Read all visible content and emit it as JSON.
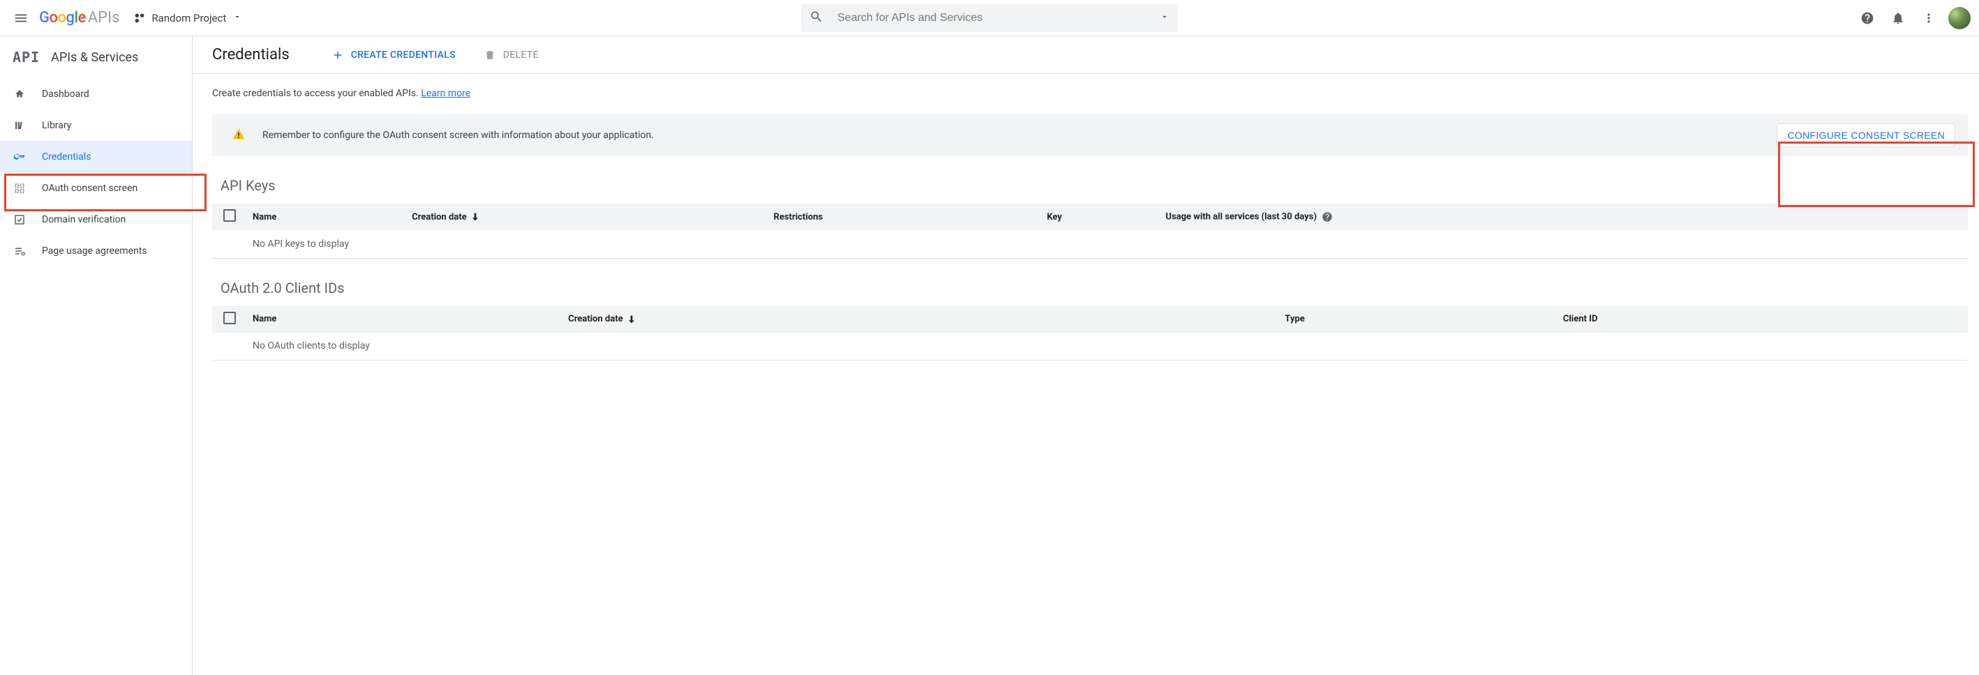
{
  "header": {
    "logo_apis": "APIs",
    "project_name": "Random Project",
    "search_placeholder": "Search for APIs and Services"
  },
  "sidebar": {
    "section_title": "APIs & Services",
    "api_mark": "API",
    "items": [
      {
        "label": "Dashboard"
      },
      {
        "label": "Library"
      },
      {
        "label": "Credentials"
      },
      {
        "label": "OAuth consent screen"
      },
      {
        "label": "Domain verification"
      },
      {
        "label": "Page usage agreements"
      }
    ]
  },
  "page": {
    "title": "Credentials",
    "create_label": "Create Credentials",
    "delete_label": "Delete",
    "intro_text": "Create credentials to access your enabled APIs. ",
    "learn_more": "Learn more"
  },
  "banner": {
    "message": "Remember to configure the OAuth consent screen with information about your application.",
    "button": "CONFIGURE CONSENT SCREEN"
  },
  "api_keys": {
    "heading": "API Keys",
    "columns": {
      "name": "Name",
      "creation_date": "Creation date",
      "restrictions": "Restrictions",
      "key": "Key",
      "usage": "Usage with all services (last 30 days)"
    },
    "empty": "No API keys to display"
  },
  "oauth_clients": {
    "heading": "OAuth 2.0 Client IDs",
    "columns": {
      "name": "Name",
      "creation_date": "Creation date",
      "type": "Type",
      "client_id": "Client ID"
    },
    "empty": "No OAuth clients to display"
  }
}
